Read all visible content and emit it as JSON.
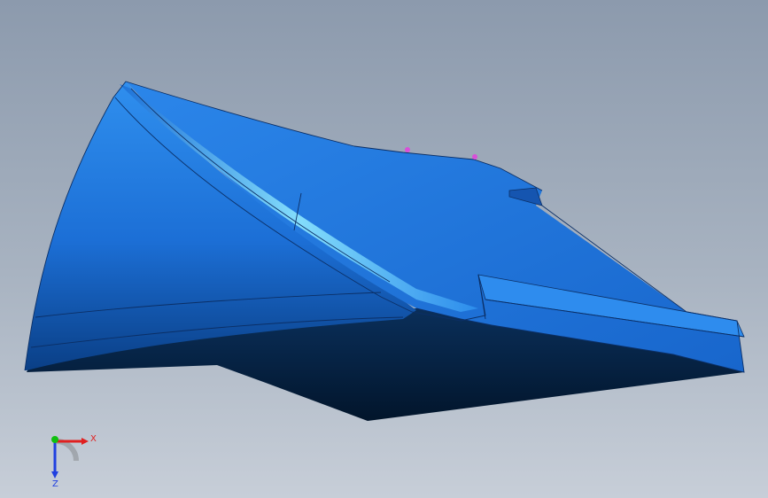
{
  "viewport": {
    "background_top": "#8c9aad",
    "background_bottom": "#c7ced8"
  },
  "model": {
    "color": "#1f78e0",
    "shadow_color": "#05213d",
    "highlight_color": "#7fe3ff",
    "marker_color": "#d94fd9"
  },
  "triad": {
    "x_label": "X",
    "z_label": "Z",
    "x_color": "#e02020",
    "y_color": "#10c010",
    "z_color": "#2040e0"
  }
}
